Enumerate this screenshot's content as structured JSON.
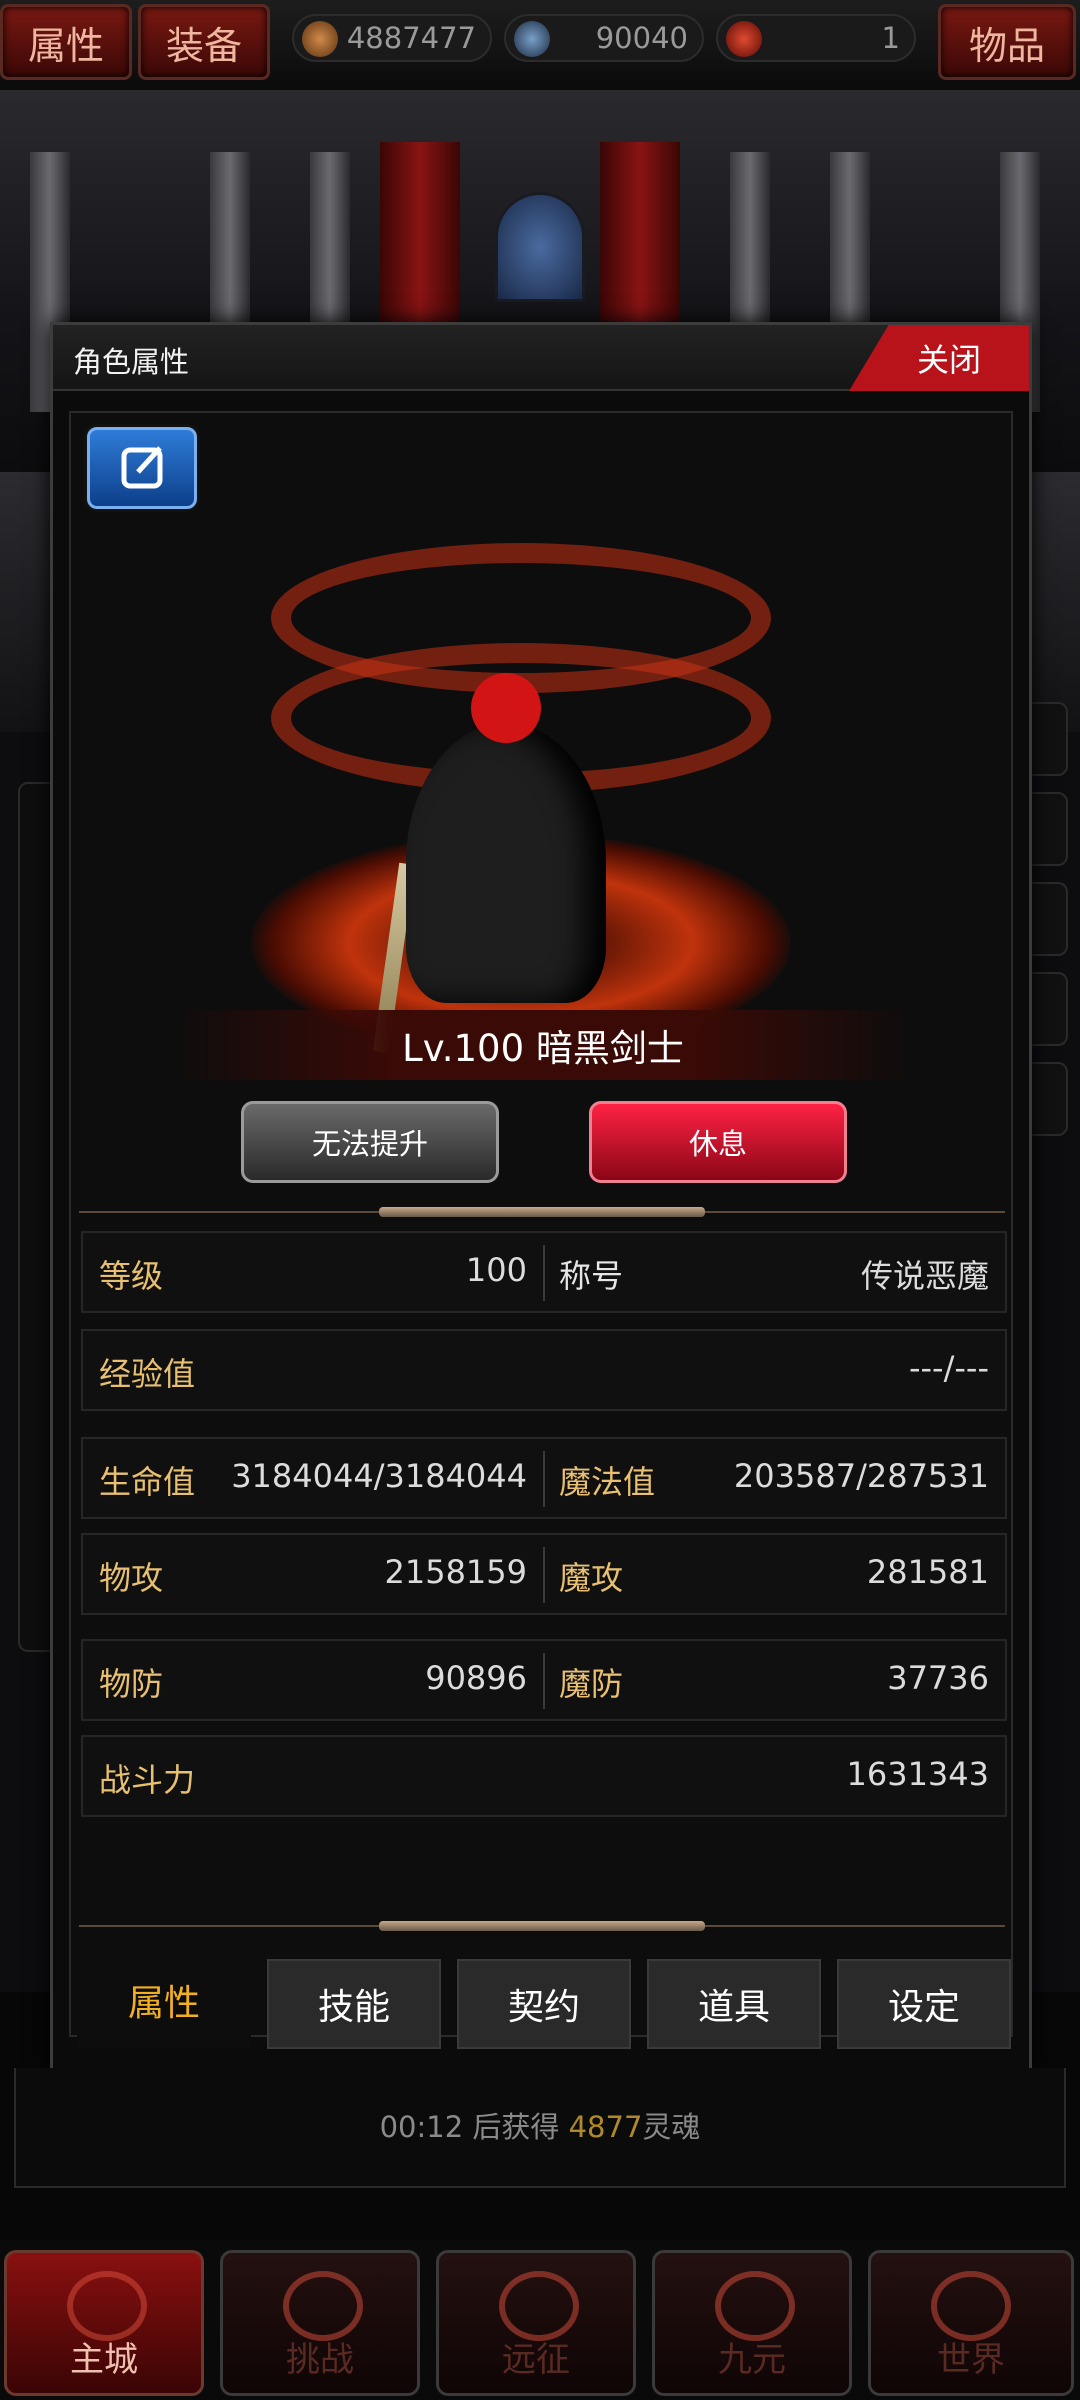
{
  "topbar": {
    "tabs": [
      "属性",
      "装备"
    ],
    "resources": [
      {
        "icon": "gold-coin-icon",
        "value": "4887477"
      },
      {
        "icon": "skull-icon",
        "value": "90040"
      },
      {
        "icon": "soul-orb-icon",
        "value": "1"
      }
    ],
    "items_button": "物品"
  },
  "modal": {
    "title": "角色属性",
    "close": "关闭",
    "level_name": "Lv.100 暗黑剑士",
    "upgrade_button": "无法提升",
    "rest_button": "休息",
    "stats": {
      "level_label": "等级",
      "level_value": "100",
      "title_label": "称号",
      "title_value": "传说恶魔",
      "exp_label": "经验值",
      "exp_value": "---/---",
      "hp_label": "生命值",
      "hp_value": "3184044/3184044",
      "mp_label": "魔法值",
      "mp_value": "203587/287531",
      "patk_label": "物攻",
      "patk_value": "2158159",
      "matk_label": "魔攻",
      "matk_value": "281581",
      "pdef_label": "物防",
      "pdef_value": "90896",
      "mdef_label": "魔防",
      "mdef_value": "37736",
      "power_label": "战斗力",
      "power_value": "1631343"
    },
    "tabs": [
      "属性",
      "技能",
      "契约",
      "道具",
      "设定"
    ]
  },
  "timer": {
    "prefix": "00:12 后获得 ",
    "amount": "4877",
    "suffix": "灵魂"
  },
  "bottom_nav": [
    "主城",
    "挑战",
    "远征",
    "九元",
    "世界"
  ],
  "colors": {
    "accent_red": "#b8121a",
    "gold": "#e8c070",
    "active_tab": "#f2b020"
  }
}
